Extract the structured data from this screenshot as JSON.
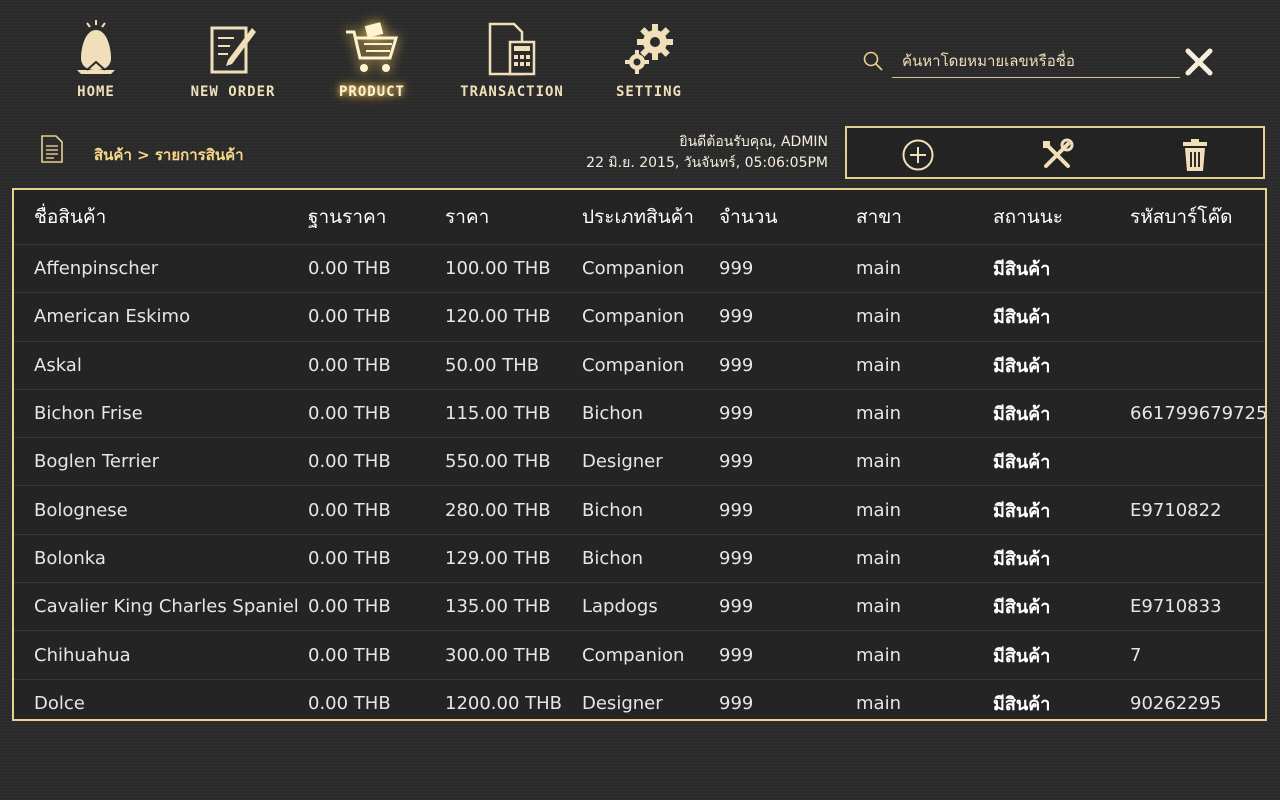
{
  "nav": {
    "items": [
      {
        "label": "HOME",
        "icon": "egg-icon"
      },
      {
        "label": "NEW ORDER",
        "icon": "new-order-icon"
      },
      {
        "label": "PRODUCT",
        "icon": "cart-icon"
      },
      {
        "label": "TRANSACTION",
        "icon": "calculator-document-icon"
      },
      {
        "label": "SETTING",
        "icon": "gears-icon"
      }
    ],
    "active": "PRODUCT"
  },
  "search": {
    "placeholder": "ค้นหาโดยหมายเลขหรือชื่อ",
    "value": ""
  },
  "breadcrumb": "สินค้า > รายการสินค้า",
  "welcome": {
    "line1": "ยินดีต้อนรับคุณ, ADMIN",
    "line2": "22 มิ.ย. 2015, วันจันทร์, 05:06:05PM"
  },
  "actions": [
    "add-icon",
    "tools-icon",
    "trash-icon"
  ],
  "colors": {
    "accent": "#e8cf92",
    "label": "#f6d88a"
  },
  "table": {
    "headers": [
      "ชื่อสินค้า",
      "ฐานราคา",
      "ราคา",
      "ประเภทสินค้า",
      "จำนวน",
      "สาขา",
      "สถานนะ",
      "รหัสบาร์โค๊ด"
    ],
    "rows": [
      [
        "Affenpinscher",
        "0.00 THB",
        "100.00 THB",
        "Companion",
        "999",
        "main",
        "มีสินค้า",
        ""
      ],
      [
        "American Eskimo",
        "0.00 THB",
        "120.00 THB",
        "Companion",
        "999",
        "main",
        "มีสินค้า",
        ""
      ],
      [
        "Askal",
        "0.00 THB",
        "50.00 THB",
        "Companion",
        "999",
        "main",
        "มีสินค้า",
        ""
      ],
      [
        "Bichon Frise",
        "0.00 THB",
        "115.00 THB",
        "Bichon",
        "999",
        "main",
        "มีสินค้า",
        "661799679725"
      ],
      [
        "Boglen Terrier",
        "0.00 THB",
        "550.00 THB",
        "Designer",
        "999",
        "main",
        "มีสินค้า",
        ""
      ],
      [
        "Bolognese",
        "0.00 THB",
        "280.00 THB",
        "Bichon",
        "999",
        "main",
        "มีสินค้า",
        "E9710822"
      ],
      [
        "Bolonka",
        "0.00 THB",
        "129.00 THB",
        "Bichon",
        "999",
        "main",
        "มีสินค้า",
        ""
      ],
      [
        "Cavalier King Charles Spaniel",
        "0.00 THB",
        "135.00 THB",
        "Lapdogs",
        "999",
        "main",
        "มีสินค้า",
        "E9710833"
      ],
      [
        "Chihuahua",
        "0.00 THB",
        "300.00 THB",
        "Companion",
        "999",
        "main",
        "มีสินค้า",
        "7"
      ],
      [
        "Dolce",
        "0.00 THB",
        "1200.00 THB",
        "Designer",
        "999",
        "main",
        "มีสินค้า",
        "90262295"
      ]
    ]
  }
}
